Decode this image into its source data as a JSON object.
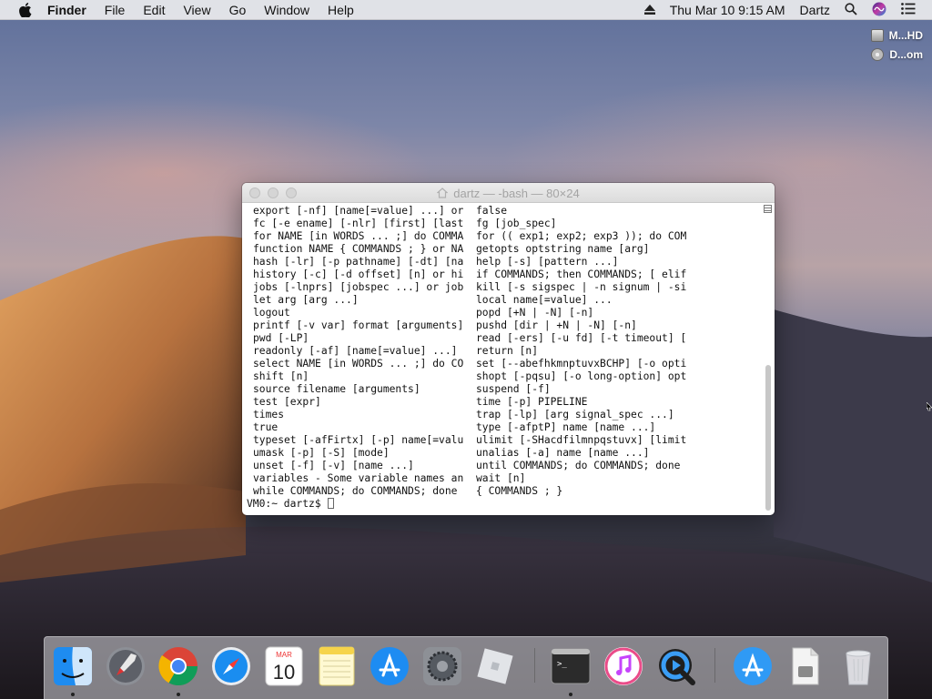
{
  "menubar": {
    "app_name": "Finder",
    "menus": [
      "File",
      "Edit",
      "View",
      "Go",
      "Window",
      "Help"
    ],
    "datetime": "Thu Mar 10  9:15 AM",
    "user": "Dartz"
  },
  "desktop": {
    "disks": [
      "M...HD",
      "D...om"
    ]
  },
  "terminal": {
    "title": "dartz — -bash — 80×24",
    "rows": [
      [
        "export [-nf] [name[=value] ...] or",
        "false"
      ],
      [
        "fc [-e ename] [-nlr] [first] [last",
        "fg [job_spec]"
      ],
      [
        "for NAME [in WORDS ... ;] do COMMA",
        "for (( exp1; exp2; exp3 )); do COM"
      ],
      [
        "function NAME { COMMANDS ; } or NA",
        "getopts optstring name [arg]"
      ],
      [
        "hash [-lr] [-p pathname] [-dt] [na",
        "help [-s] [pattern ...]"
      ],
      [
        "history [-c] [-d offset] [n] or hi",
        "if COMMANDS; then COMMANDS; [ elif"
      ],
      [
        "jobs [-lnprs] [jobspec ...] or job",
        "kill [-s sigspec | -n signum | -si"
      ],
      [
        "let arg [arg ...]",
        "local name[=value] ..."
      ],
      [
        "logout",
        "popd [+N | -N] [-n]"
      ],
      [
        "printf [-v var] format [arguments]",
        "pushd [dir | +N | -N] [-n]"
      ],
      [
        "pwd [-LP]",
        "read [-ers] [-u fd] [-t timeout] ["
      ],
      [
        "readonly [-af] [name[=value] ...]",
        "return [n]"
      ],
      [
        "select NAME [in WORDS ... ;] do CO",
        "set [--abefhkmnptuvxBCHP] [-o opti"
      ],
      [
        "shift [n]",
        "shopt [-pqsu] [-o long-option] opt"
      ],
      [
        "source filename [arguments]",
        "suspend [-f]"
      ],
      [
        "test [expr]",
        "time [-p] PIPELINE"
      ],
      [
        "times",
        "trap [-lp] [arg signal_spec ...]"
      ],
      [
        "true",
        "type [-afptP] name [name ...]"
      ],
      [
        "typeset [-afFirtx] [-p] name[=valu",
        "ulimit [-SHacdfilmnpqstuvx] [limit"
      ],
      [
        "umask [-p] [-S] [mode]",
        "unalias [-a] name [name ...]"
      ],
      [
        "unset [-f] [-v] [name ...]",
        "until COMMANDS; do COMMANDS; done"
      ],
      [
        "variables - Some variable names an",
        "wait [n]"
      ],
      [
        "while COMMANDS; do COMMANDS; done",
        "{ COMMANDS ; }"
      ]
    ],
    "prompt": "VM0:~ dartz$ "
  },
  "dock": {
    "calendar": {
      "month": "MAR",
      "day": "10"
    },
    "items": [
      "finder-icon",
      "launchpad-icon",
      "chrome-icon",
      "safari-icon",
      "calendar-icon",
      "notes-icon",
      "app-store-icon",
      "system-preferences-icon",
      "roblox-icon",
      "terminal-icon",
      "itunes-icon",
      "quicktime-icon",
      "app-store-download-icon",
      "document-icon",
      "trash-icon"
    ]
  },
  "colors": {
    "accent": "#1f7ef4",
    "terminal_bg": "#ffffff",
    "menubar_bg": "#ececee"
  }
}
